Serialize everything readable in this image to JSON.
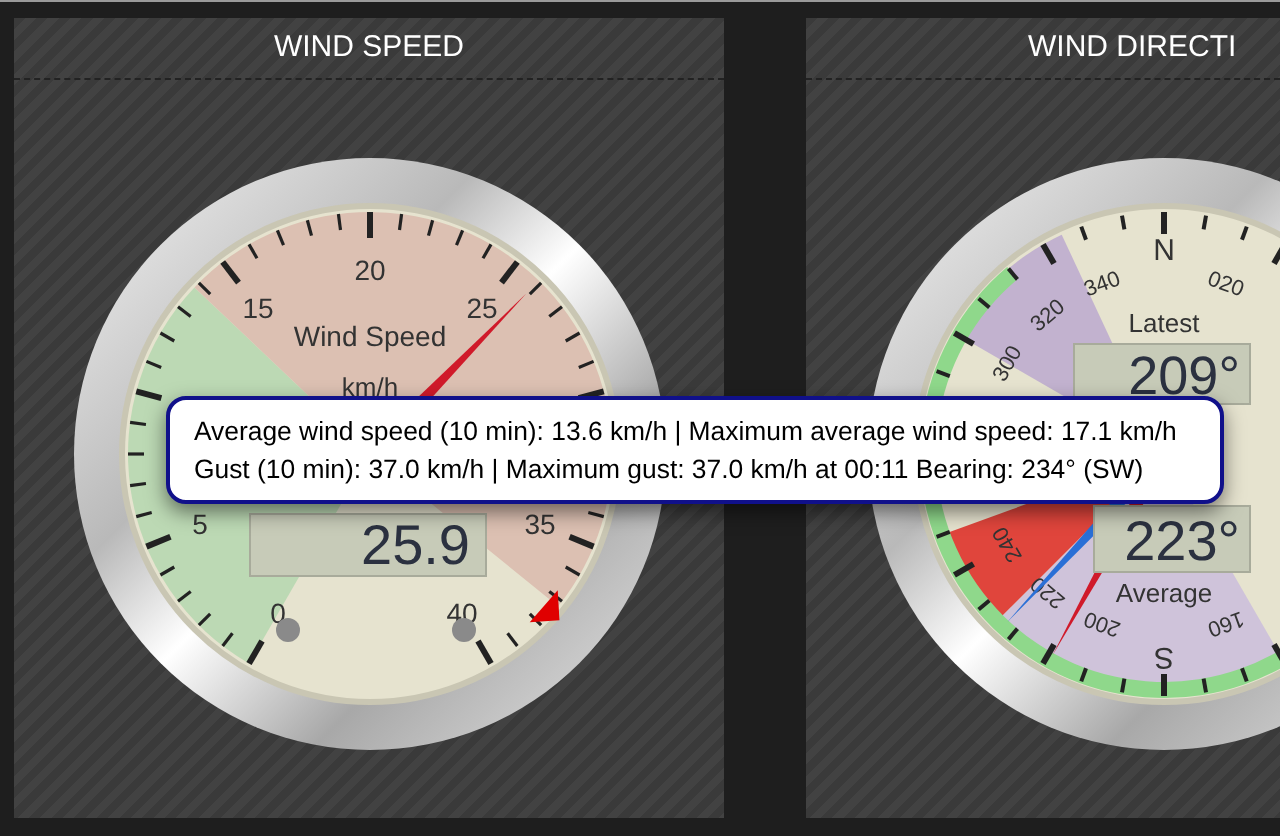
{
  "panels": [
    {
      "title": "WIND SPEED",
      "gauge": {
        "kind": "speed",
        "scale_labels": [
          "0",
          "5",
          "15",
          "20",
          "25",
          "35",
          "40"
        ],
        "caption": "Wind Speed",
        "unit": "km/h",
        "reading": "25.9",
        "level": 0.6475
      }
    },
    {
      "title": "WIND DIRECTI",
      "gauge": {
        "kind": "direction",
        "scale_labels": [
          "N",
          "340",
          "020",
          "320",
          "300",
          "240",
          "220",
          "200",
          "160",
          "S"
        ],
        "latest_label": "Latest",
        "latest": "209°",
        "average": "223°",
        "average_label": "Average"
      }
    }
  ],
  "tooltip": {
    "lines": [
      "Average wind speed (10 min): 13.6 km/h | Maximum average wind speed: 17.1 km/h",
      "Gust (10 min): 37.0 km/h | Maximum gust: 37.0 km/h at 00:11 Bearing: 234° (SW)"
    ]
  }
}
